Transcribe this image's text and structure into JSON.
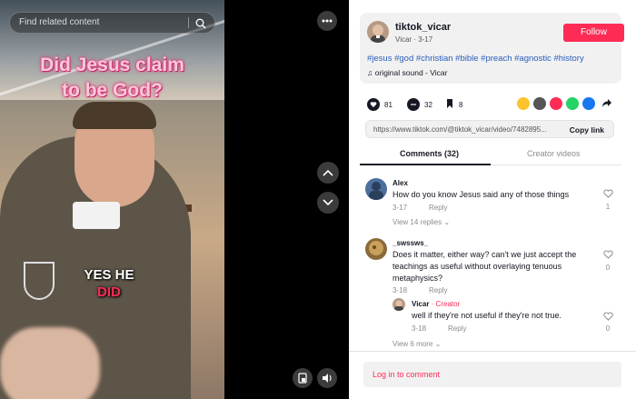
{
  "video": {
    "search_placeholder": "Find related content",
    "title_line1": "Did Jesus claim",
    "title_line2": "to be God?",
    "caption_line1": "YES HE",
    "caption_line2": "DID"
  },
  "post": {
    "username": "tiktok_vicar",
    "subline": "Vicar · 3-17",
    "follow_label": "Follow",
    "hashtags": "#jesus #god #christian #bible #preach #agnostic #history",
    "sound": "original sound - Vicar",
    "likes": "81",
    "comments": "32",
    "saves": "8",
    "url": "https://www.tiktok.com/@tiktok_vicar/video/7482895...",
    "copy_label": "Copy link"
  },
  "tabs": {
    "comments": "Comments (32)",
    "creator": "Creator videos"
  },
  "comments": [
    {
      "user": "Alex",
      "text": "How do you know Jesus said any of those things",
      "date": "3-17",
      "reply": "Reply",
      "likes": "1",
      "view_replies": "View 14 replies"
    },
    {
      "user": "_swssws_",
      "text_line1": "Does it matter, either way? can't we just accept the",
      "text_line2": "teachings as useful without overlaying tenuous",
      "text_line3": "metaphysics?",
      "date": "3-18",
      "reply": "Reply",
      "likes": "0"
    }
  ],
  "reply": {
    "user": "Vicar",
    "badge": "· Creator",
    "text": "well if they're not useful if they're not true.",
    "date": "3-18",
    "reply": "Reply",
    "likes": "0",
    "view_more": "View 6 more"
  },
  "login": "Log in to comment",
  "colors": {
    "accent": "#fe2c55",
    "hashtag": "#2b5db9"
  }
}
